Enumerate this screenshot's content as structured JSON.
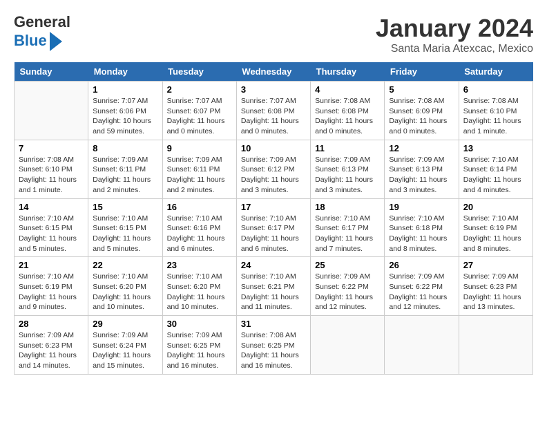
{
  "header": {
    "logo_line1": "General",
    "logo_line2": "Blue",
    "month_title": "January 2024",
    "location": "Santa Maria Atexcac, Mexico"
  },
  "weekdays": [
    "Sunday",
    "Monday",
    "Tuesday",
    "Wednesday",
    "Thursday",
    "Friday",
    "Saturday"
  ],
  "weeks": [
    [
      {
        "day": "",
        "sunrise": "",
        "sunset": "",
        "daylight": ""
      },
      {
        "day": "1",
        "sunrise": "7:07 AM",
        "sunset": "6:06 PM",
        "daylight": "10 hours and 59 minutes."
      },
      {
        "day": "2",
        "sunrise": "7:07 AM",
        "sunset": "6:07 PM",
        "daylight": "11 hours and 0 minutes."
      },
      {
        "day": "3",
        "sunrise": "7:07 AM",
        "sunset": "6:08 PM",
        "daylight": "11 hours and 0 minutes."
      },
      {
        "day": "4",
        "sunrise": "7:08 AM",
        "sunset": "6:08 PM",
        "daylight": "11 hours and 0 minutes."
      },
      {
        "day": "5",
        "sunrise": "7:08 AM",
        "sunset": "6:09 PM",
        "daylight": "11 hours and 0 minutes."
      },
      {
        "day": "6",
        "sunrise": "7:08 AM",
        "sunset": "6:10 PM",
        "daylight": "11 hours and 1 minute."
      }
    ],
    [
      {
        "day": "7",
        "sunrise": "7:08 AM",
        "sunset": "6:10 PM",
        "daylight": "11 hours and 1 minute."
      },
      {
        "day": "8",
        "sunrise": "7:09 AM",
        "sunset": "6:11 PM",
        "daylight": "11 hours and 2 minutes."
      },
      {
        "day": "9",
        "sunrise": "7:09 AM",
        "sunset": "6:11 PM",
        "daylight": "11 hours and 2 minutes."
      },
      {
        "day": "10",
        "sunrise": "7:09 AM",
        "sunset": "6:12 PM",
        "daylight": "11 hours and 3 minutes."
      },
      {
        "day": "11",
        "sunrise": "7:09 AM",
        "sunset": "6:13 PM",
        "daylight": "11 hours and 3 minutes."
      },
      {
        "day": "12",
        "sunrise": "7:09 AM",
        "sunset": "6:13 PM",
        "daylight": "11 hours and 3 minutes."
      },
      {
        "day": "13",
        "sunrise": "7:10 AM",
        "sunset": "6:14 PM",
        "daylight": "11 hours and 4 minutes."
      }
    ],
    [
      {
        "day": "14",
        "sunrise": "7:10 AM",
        "sunset": "6:15 PM",
        "daylight": "11 hours and 5 minutes."
      },
      {
        "day": "15",
        "sunrise": "7:10 AM",
        "sunset": "6:15 PM",
        "daylight": "11 hours and 5 minutes."
      },
      {
        "day": "16",
        "sunrise": "7:10 AM",
        "sunset": "6:16 PM",
        "daylight": "11 hours and 6 minutes."
      },
      {
        "day": "17",
        "sunrise": "7:10 AM",
        "sunset": "6:17 PM",
        "daylight": "11 hours and 6 minutes."
      },
      {
        "day": "18",
        "sunrise": "7:10 AM",
        "sunset": "6:17 PM",
        "daylight": "11 hours and 7 minutes."
      },
      {
        "day": "19",
        "sunrise": "7:10 AM",
        "sunset": "6:18 PM",
        "daylight": "11 hours and 8 minutes."
      },
      {
        "day": "20",
        "sunrise": "7:10 AM",
        "sunset": "6:19 PM",
        "daylight": "11 hours and 8 minutes."
      }
    ],
    [
      {
        "day": "21",
        "sunrise": "7:10 AM",
        "sunset": "6:19 PM",
        "daylight": "11 hours and 9 minutes."
      },
      {
        "day": "22",
        "sunrise": "7:10 AM",
        "sunset": "6:20 PM",
        "daylight": "11 hours and 10 minutes."
      },
      {
        "day": "23",
        "sunrise": "7:10 AM",
        "sunset": "6:20 PM",
        "daylight": "11 hours and 10 minutes."
      },
      {
        "day": "24",
        "sunrise": "7:10 AM",
        "sunset": "6:21 PM",
        "daylight": "11 hours and 11 minutes."
      },
      {
        "day": "25",
        "sunrise": "7:09 AM",
        "sunset": "6:22 PM",
        "daylight": "11 hours and 12 minutes."
      },
      {
        "day": "26",
        "sunrise": "7:09 AM",
        "sunset": "6:22 PM",
        "daylight": "11 hours and 12 minutes."
      },
      {
        "day": "27",
        "sunrise": "7:09 AM",
        "sunset": "6:23 PM",
        "daylight": "11 hours and 13 minutes."
      }
    ],
    [
      {
        "day": "28",
        "sunrise": "7:09 AM",
        "sunset": "6:23 PM",
        "daylight": "11 hours and 14 minutes."
      },
      {
        "day": "29",
        "sunrise": "7:09 AM",
        "sunset": "6:24 PM",
        "daylight": "11 hours and 15 minutes."
      },
      {
        "day": "30",
        "sunrise": "7:09 AM",
        "sunset": "6:25 PM",
        "daylight": "11 hours and 16 minutes."
      },
      {
        "day": "31",
        "sunrise": "7:08 AM",
        "sunset": "6:25 PM",
        "daylight": "11 hours and 16 minutes."
      },
      {
        "day": "",
        "sunrise": "",
        "sunset": "",
        "daylight": ""
      },
      {
        "day": "",
        "sunrise": "",
        "sunset": "",
        "daylight": ""
      },
      {
        "day": "",
        "sunrise": "",
        "sunset": "",
        "daylight": ""
      }
    ]
  ]
}
